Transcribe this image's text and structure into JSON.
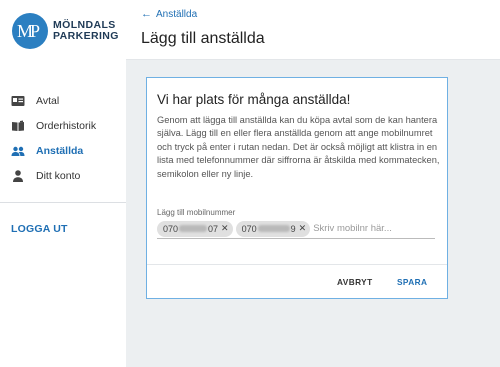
{
  "brand": {
    "line1": "MÖLNDALS",
    "line2": "PARKERING",
    "color": "#2b7fc1",
    "icon": "mp-logo-icon"
  },
  "sidebar": {
    "items": [
      {
        "label": "Avtal",
        "icon": "id-card-icon",
        "active": false
      },
      {
        "label": "Orderhistorik",
        "icon": "book-icon",
        "active": false
      },
      {
        "label": "Anställda",
        "icon": "people-icon",
        "active": true
      },
      {
        "label": "Ditt konto",
        "icon": "person-icon",
        "active": false
      }
    ],
    "logout": "LOGGA UT"
  },
  "header": {
    "back_label": "Anställda",
    "title": "Lägg till anställda"
  },
  "card": {
    "title": "Vi har plats för många anställda!",
    "description": "Genom att lägga till anställda kan du köpa avtal som de kan hantera själva. Lägg till en eller flera anställda genom att ange mobilnumret och tryck på enter i rutan nedan. Det är också möjligt att klistra in en lista med telefonnummer där siffrorna är åtskilda med kommatecken, semikolon eller ny linje.",
    "field_label": "Lägg till mobilnummer",
    "chips": [
      {
        "prefix": "070",
        "suffix": "07"
      },
      {
        "prefix": "070",
        "suffix": "9"
      }
    ],
    "input_placeholder": "Skriv mobilnr här...",
    "cancel_label": "AVBRYT",
    "save_label": "SPARA"
  },
  "colors": {
    "accent": "#1f6fb4",
    "card_border": "#6fb0e3",
    "background": "#eceff1"
  }
}
